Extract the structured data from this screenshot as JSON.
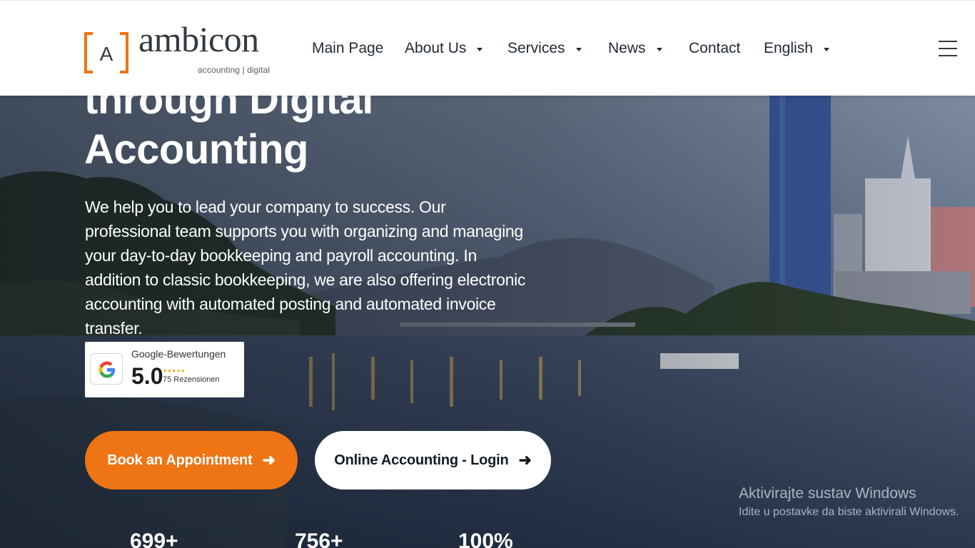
{
  "brand": {
    "name": "ambicon",
    "tagline": "accounting | digital",
    "mark_letter": "A",
    "accent_color": "#ef7413"
  },
  "nav": {
    "items": [
      {
        "label": "Main Page",
        "has_dropdown": false
      },
      {
        "label": "About Us",
        "has_dropdown": true
      },
      {
        "label": "Services",
        "has_dropdown": true
      },
      {
        "label": "News",
        "has_dropdown": true
      },
      {
        "label": "Contact",
        "has_dropdown": false
      },
      {
        "label": "English",
        "has_dropdown": true
      }
    ],
    "menu_icon": "hamburger-menu-icon"
  },
  "hero": {
    "title_line1": "through Digital",
    "title_line2": "Accounting",
    "description": "We help you to lead your company to success. Our professional team supports you with organizing and managing your day-to-day bookkeeping and payroll accounting. In addition to classic bookkeeping, we are also offering electronic accounting with automated posting and automated invoice transfer."
  },
  "reviews": {
    "title": "Google-Bewertungen",
    "score": "5.0",
    "stars": "★★★★★",
    "count": "75 Rezensionen",
    "icon": "google-g-icon"
  },
  "buttons": {
    "primary_label": "Book an Appointment",
    "secondary_label": "Online Accounting - Login",
    "arrow": "➜"
  },
  "stats": [
    "699+",
    "756+",
    "100%"
  ],
  "os_watermark": {
    "line1": "Aktivirajte sustav Windows",
    "line2": "Idite u postavke da biste aktivirali Windows."
  }
}
